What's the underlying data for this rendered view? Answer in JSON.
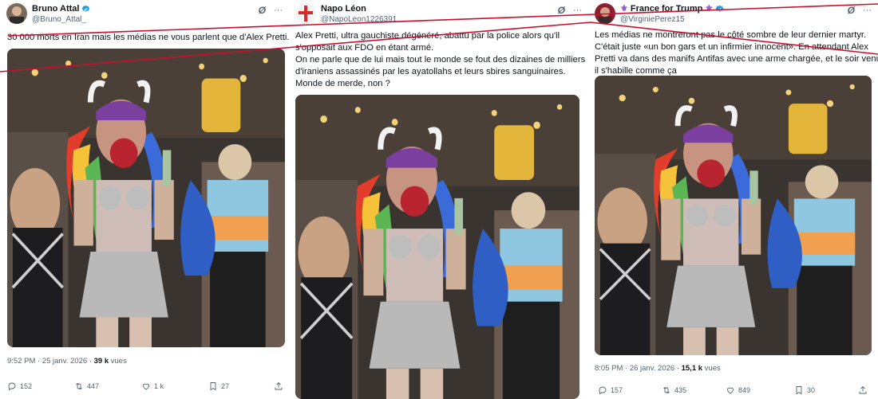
{
  "tweets": [
    {
      "author": "Bruno Attal",
      "handle": "@Bruno_Attal_",
      "text_lines": [
        "30 000 morts en Iran mais les médias ne vous parlent que d'Alex Pretti."
      ],
      "time": "9:52 PM · 25 janv. 2026 ·",
      "views_count": "39 k",
      "views_label": "vues",
      "replies": "152",
      "reposts": "447",
      "likes": "1 k",
      "bookmarks": "27"
    },
    {
      "author": "Napo Léon",
      "handle": "@NapoLeon1226391",
      "text_lines": [
        "Alex Pretti, ultra gauchiste dégénéré, abattu par la police alors qu'il",
        "s'opposait aux FDO en étant armé.",
        "On ne parle que de lui mais tout le monde se fout des dizaines de milliers",
        "d'iraniens assassinés par les ayatollahs et leurs sbires sanguinaires.",
        "Monde de merde, non ?"
      ]
    },
    {
      "author": "France for Trump",
      "handle": "@VirginiePerez15",
      "text_lines": [
        "Les médias ne montreront pas le côté sombre de leur dernier martyr.",
        "C'était juste «un bon gars et un infirmier innocent». En attendant Alex",
        "Pretti va dans des manifs Antifas avec une arme chargée, et le soir venu",
        "il s'habille comme ça"
      ],
      "time": "8:05 PM · 26 janv. 2026 ·",
      "views_count": "15,1 k",
      "views_label": "vues",
      "replies": "157",
      "reposts": "435",
      "likes": "849",
      "bookmarks": "30"
    }
  ],
  "icons": {
    "more": "more-icon",
    "grok": "grok-icon",
    "verified": "verified-badge-icon",
    "reply": "reply-icon",
    "repost": "repost-icon",
    "like": "like-icon",
    "bookmark": "bookmark-icon",
    "share": "share-icon"
  },
  "colors": {
    "verified": "#1d9bf0",
    "text": "#0f1419",
    "muted": "#536471",
    "strike": "#c8102e"
  }
}
